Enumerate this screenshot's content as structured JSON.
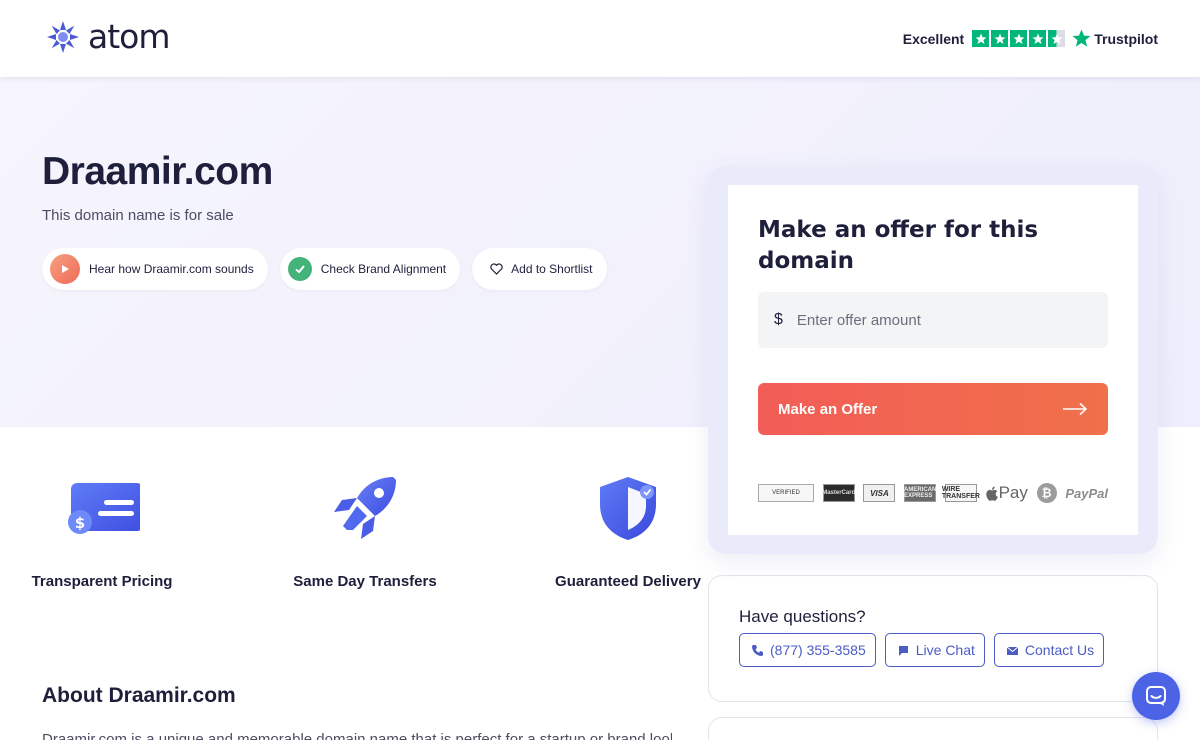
{
  "header": {
    "logo_text": "atom",
    "trust": {
      "label": "Excellent",
      "brand": "Trustpilot",
      "rating_stars": 4.5
    }
  },
  "hero": {
    "domain": "Draamir.com",
    "subtitle": "This domain name is for sale",
    "pills": {
      "hear": "Hear how Draamir.com sounds",
      "brand": "Check Brand Alignment",
      "shortlist": "Add to Shortlist"
    }
  },
  "offer": {
    "heading": "Make an offer for this domain",
    "currency_symbol": "$",
    "input_placeholder": "Enter offer amount",
    "button_label": "Make an Offer",
    "payment_methods": [
      "VERIFIED",
      "MasterCard",
      "VISA",
      "AMERICAN EXPRESS",
      "WIRE TRANSFER",
      "Pay",
      "₿",
      "PayPal"
    ]
  },
  "features": [
    {
      "label": "Transparent Pricing",
      "icon": "pricing-card-icon"
    },
    {
      "label": "Same Day Transfers",
      "icon": "rocket-icon"
    },
    {
      "label": "Guaranteed Delivery",
      "icon": "shield-icon"
    }
  ],
  "about": {
    "title": "About Draamir.com",
    "text": "Draamir.com is a unique and memorable domain name that is perfect for a startup or brand looking to make"
  },
  "questions": {
    "title": "Have questions?",
    "phone": "(877) 355-3585",
    "live_chat": "Live Chat",
    "contact": "Contact Us"
  },
  "colors": {
    "accent": "#4b5cc4",
    "cta_start": "#f25d57",
    "cta_end": "#f0704a",
    "trustpilot_green": "#00b67a",
    "text_dark": "#1e1f3b"
  }
}
